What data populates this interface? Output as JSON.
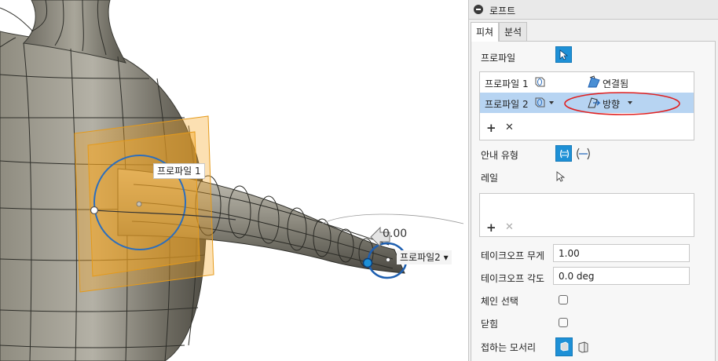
{
  "viewport": {
    "profile1_label": "프로파일 1",
    "profile2_label": "프로파일2 ▾",
    "dimension_value": "0.00"
  },
  "panel": {
    "title": "로프트",
    "tabs": [
      "피쳐",
      "분석"
    ],
    "profile_label": "프로파일",
    "profiles": [
      {
        "name": "프로파일 1",
        "condition": "연결됨"
      },
      {
        "name": "프로파일 2",
        "condition": "방향"
      }
    ],
    "guide_type_label": "안내 유형",
    "rail_label": "레일",
    "takeoff_weight_label": "테이크오프 무게",
    "takeoff_weight_value": "1.00",
    "takeoff_angle_label": "테이크오프 각도",
    "takeoff_angle_value": "0.0 deg",
    "chain_selection_label": "체인 선택",
    "closed_label": "닫힘",
    "tangent_edges_label": "접하는 모서리"
  },
  "colors": {
    "accent_blue": "#1e90d6",
    "selected_row": "#b7d4f2",
    "highlight_red": "#e02020",
    "profile_orange": "#f5a623"
  }
}
